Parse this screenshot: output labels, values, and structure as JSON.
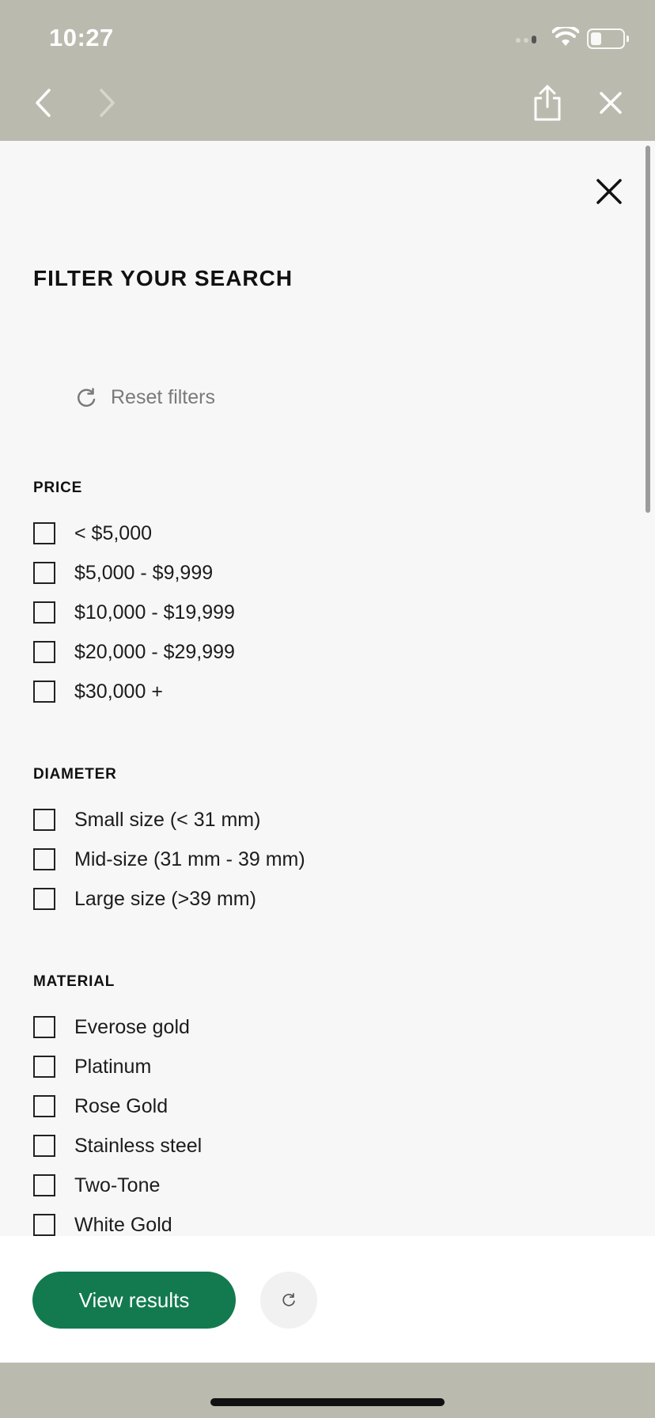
{
  "status_bar": {
    "time": "10:27"
  },
  "filter": {
    "title": "FILTER YOUR SEARCH",
    "reset_label": "Reset filters",
    "sections": {
      "price": {
        "heading": "PRICE",
        "options": [
          "< $5,000",
          "$5,000 - $9,999",
          "$10,000 - $19,999",
          "$20,000 - $29,999",
          "$30,000 +"
        ]
      },
      "diameter": {
        "heading": "DIAMETER",
        "options": [
          "Small size (< 31 mm)",
          "Mid-size (31 mm - 39 mm)",
          "Large size (>39 mm)"
        ]
      },
      "material": {
        "heading": "MATERIAL",
        "options": [
          "Everose gold",
          "Platinum",
          "Rose Gold",
          "Stainless steel",
          "Two-Tone",
          "White Gold"
        ]
      }
    }
  },
  "footer": {
    "view_results_label": "View results"
  },
  "colors": {
    "accent": "#137a4f",
    "chrome": "#bbbaae",
    "sheet": "#f7f7f7"
  },
  "icons": [
    "back-chevron-icon",
    "forward-chevron-icon",
    "share-icon",
    "close-icon",
    "reset-icon",
    "wifi-icon",
    "battery-icon"
  ]
}
